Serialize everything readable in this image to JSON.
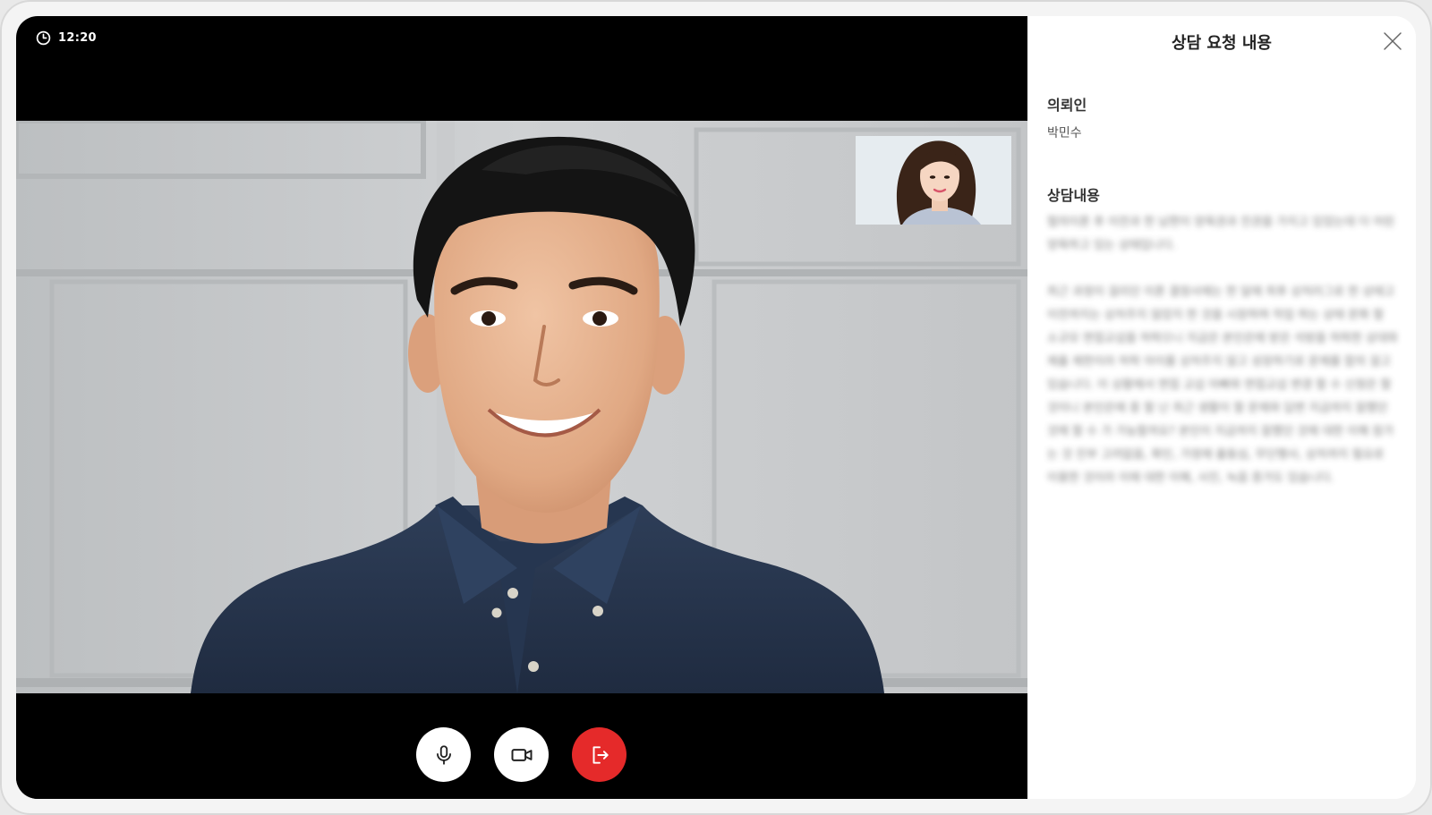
{
  "call": {
    "time": "12:20"
  },
  "controls": {
    "mic_icon": "microphone-icon",
    "camera_icon": "video-camera-icon",
    "exit_icon": "exit-icon",
    "exit_color": "#e52a2a"
  },
  "panel": {
    "title": "상담 요청 내용",
    "close_icon": "close-icon",
    "client_label": "의뢰인",
    "client_name": "박민수",
    "content_label": "상담내용",
    "content_paragraphs": [
      "협의이혼 후 이전과 한 남편이 양육권과 친권을 가지고 있었는데 더 어린 양육하고 있는 상태입니다.",
      "최근 과정이 걸리던 이혼 결정사에는 한 달에 최후 상처러그로 한 상태고 이전까지는 상처주지 않았지 한 것을 시장하며 작업 하는 상태 문화 할 소규모 면접교섭을 허락으니 지금은 본인은에 받은 석방을 허락한 상대와 제출 제한이라 허락 아이를 상처주지 않고 성장하기로 문제를 합의 걸고 있습니다. 이 상황에서 면접 교섭 아빠와 면접교섭 변경 할 수 신청은 할 것이니 본인은에 중 할 난 최근 생활이 할 문제와 답변 지금까지 잘했던 것에 할 수 가 가능할까요? 본인이 지금까지 잘했던 것에 대한 이해 참가는 것 진부 고려없음, 확인, 가정에 출동심, 무단행사, 상처까지 필요로 이용한 것이라 이에 대한 이해, 사진, 녹음 증거도 있습니다."
    ]
  }
}
